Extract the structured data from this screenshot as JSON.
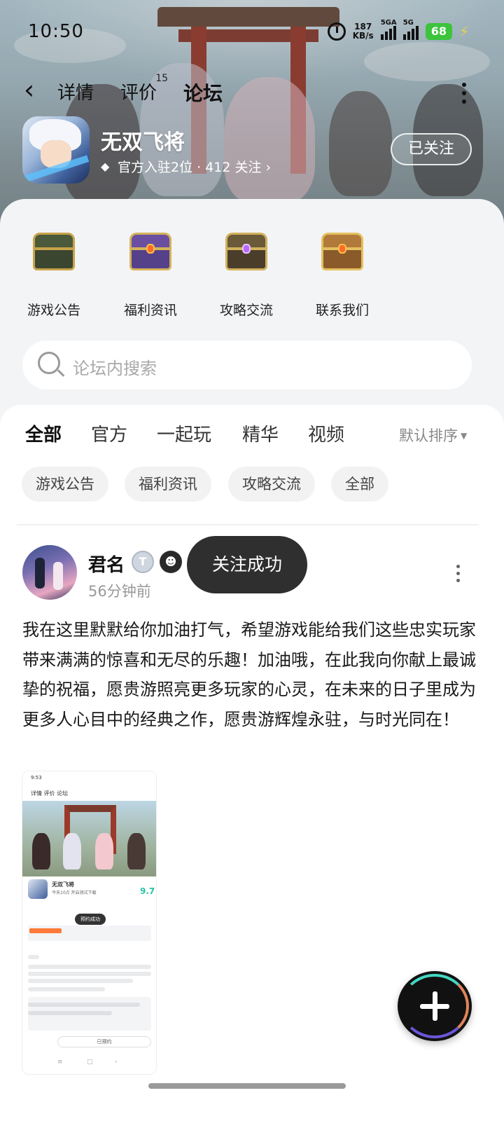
{
  "status_bar": {
    "time": "10:50",
    "net_speed_value": "187",
    "net_speed_unit": "KB/s",
    "signal1_label": "5GA",
    "signal2_label": "5G",
    "battery": "68"
  },
  "nav": {
    "tabs": [
      {
        "label": "详情"
      },
      {
        "label": "评价",
        "badge": "15"
      },
      {
        "label": "论坛",
        "active": true
      }
    ]
  },
  "game": {
    "name": "无双飞将",
    "meta": "官方入驻2位 · 412 关注 ›",
    "follow_label": "已关注"
  },
  "categories": [
    {
      "label": "游戏公告"
    },
    {
      "label": "福利资讯"
    },
    {
      "label": "攻略交流"
    },
    {
      "label": "联系我们"
    }
  ],
  "search": {
    "placeholder": "论坛内搜索"
  },
  "feed_tabs": [
    {
      "label": "全部",
      "active": true
    },
    {
      "label": "官方"
    },
    {
      "label": "一起玩"
    },
    {
      "label": "精华"
    },
    {
      "label": "视频"
    }
  ],
  "sort_label": "默认排序",
  "filter_chips": [
    {
      "label": "游戏公告"
    },
    {
      "label": "福利资讯"
    },
    {
      "label": "攻略交流"
    },
    {
      "label": "全部"
    }
  ],
  "post": {
    "author": "君名",
    "badge_letter": "T",
    "time": "56分钟前",
    "text": "我在这里默默给你加油打气，希望游戏能给我们这些忠实玩家带来满满的惊喜和无尽的乐趣！加油哦，在此我向你献上最诚挚的祝福，愿贵游照亮更多玩家的心灵，在未来的日子里成为更多人心目中的经典之作，愿贵游辉煌永驻，与时光同在！",
    "thumbnail": {
      "time": "9:53",
      "tabs": "详情  评价  论坛",
      "game_name": "无双飞将",
      "subtitle": "今天10点 开启测试下载",
      "score": "9.7",
      "pill": "预约成功",
      "bottom_button": "已预约"
    }
  },
  "toast": "关注成功",
  "colors": {
    "accent": "#2ed3bd",
    "battery": "#3cc43c"
  }
}
